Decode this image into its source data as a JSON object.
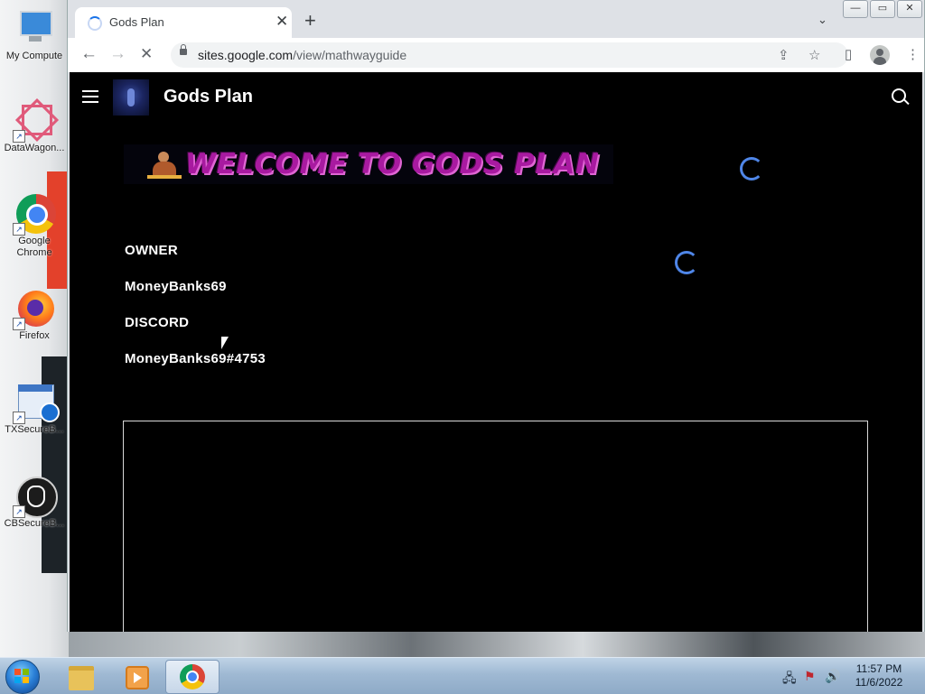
{
  "desktop": {
    "icons": [
      {
        "label": "My Compute",
        "icon": "computer-icon"
      },
      {
        "label": "DataWagon...",
        "icon": "datawagon-icon"
      },
      {
        "label": "Google Chrome",
        "icon": "chrome-icon"
      },
      {
        "label": "Firefox",
        "icon": "firefox-icon"
      },
      {
        "label": "TXSecureB...",
        "icon": "txsecure-icon"
      },
      {
        "label": "CBSecureB...",
        "icon": "cbsecure-icon"
      }
    ]
  },
  "browser": {
    "tab": {
      "title": "Gods Plan",
      "close": "✕"
    },
    "new_tab": "+",
    "tab_search": "⌄",
    "window": {
      "minimize": "—",
      "maximize": "▭",
      "close": "✕"
    },
    "nav": {
      "back": "←",
      "forward": "→",
      "stop": "✕"
    },
    "url": {
      "host": "sites.google.com",
      "path": "/view/mathwayguide"
    },
    "toolbar_icons": {
      "share": "⇪",
      "bookmark": "☆",
      "side_panel": "▯",
      "menu": "⋮"
    }
  },
  "page": {
    "site_title": "Gods Plan",
    "banner_text": "WELCOME TO GODS PLAN",
    "owner_heading": "OWNER",
    "owner_name": "MoneyBanks69",
    "discord_heading": "DISCORD",
    "discord_tag": "MoneyBanks69#4753"
  },
  "taskbar": {
    "time": "11:57 PM",
    "date": "11/6/2022",
    "tray": {
      "network": "🖧",
      "flag": "⚑",
      "volume": "🔊"
    }
  },
  "colors": {
    "page_bg": "#000000",
    "banner_text": "#a81aa0",
    "spinner": "#4f86e8",
    "chrome_accent": "#1a73e8"
  }
}
